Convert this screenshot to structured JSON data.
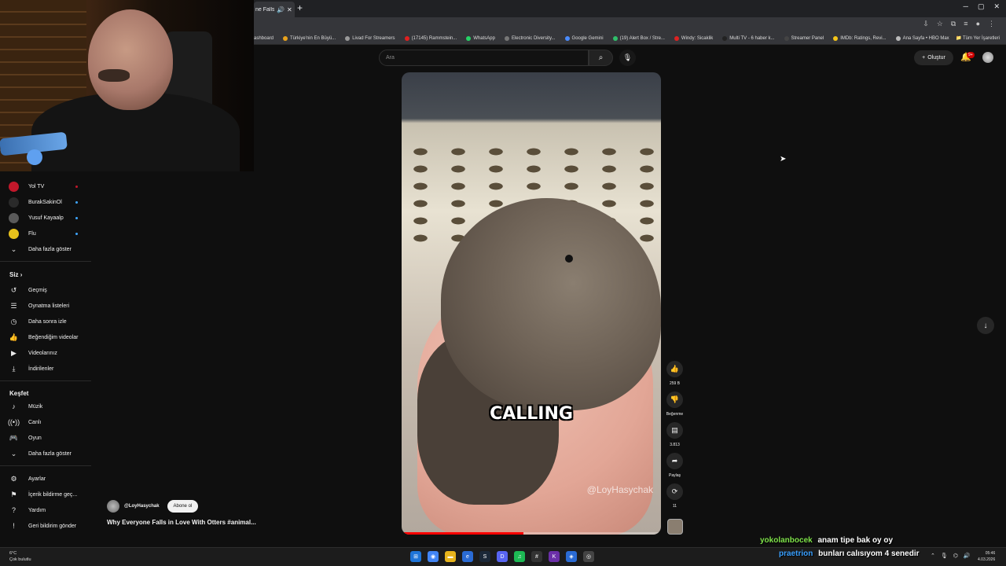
{
  "browser": {
    "tab_title": "ne Falls",
    "bookmarks": [
      "ashboard",
      "Türkiye'nin En Büyü...",
      "Livad For Streamers",
      "(17145) Rammstein...",
      "WhatsApp",
      "Electronic Diversity...",
      "Google Gemini",
      "(19) Alert Box / Stre...",
      "Windy: Sicaklik",
      "Multi TV - 6 haber k...",
      "Streamer Panel",
      "IMDb: Ratings, Revi...",
      "Ana Sayfa • HBO Max"
    ],
    "all_bookmarks": "Tüm Yer İşaretleri"
  },
  "header": {
    "search_placeholder": "Ara",
    "create_label": "Oluştur",
    "notification_count": "9+"
  },
  "sidebar": {
    "subscriptions": [
      {
        "label": "Yol TV",
        "color": "#c2182b"
      },
      {
        "label": "BurakSakinOl",
        "color": "#2a2a2a"
      },
      {
        "label": "Yusuf Kayaalp",
        "color": "#5a5a5a"
      },
      {
        "label": "Flu",
        "color": "#e8c21c"
      }
    ],
    "show_more": "Daha fazla göster",
    "you_heading": "Siz",
    "you_items": [
      "Geçmiş",
      "Oynatma listeleri",
      "Daha sonra izle",
      "Beğendiğim videolar",
      "Videolarınız",
      "İndirilenler"
    ],
    "explore_heading": "Keşfet",
    "explore_items": [
      "Müzik",
      "Canlı",
      "Oyun",
      "Daha fazla göster"
    ],
    "settings_items": [
      "Ayarlar",
      "İçerik bildirme geç...",
      "Yardım",
      "Geri bildirim gönder"
    ]
  },
  "short": {
    "caption": "CALLING",
    "watermark": "@LoyHasychak",
    "progress": 0.47,
    "channel": "@LoyHasychak",
    "subscribe_label": "Abone ol",
    "title": "Why Everyone Falls in Love With Otters #animal...",
    "likes": "259 B",
    "dislike_label": "Beğenme",
    "comments": "3.813",
    "share_label": "Paylaş",
    "remix_count": "11"
  },
  "chat": [
    {
      "user": "yokolanbocek",
      "user_color": "#7fe34a",
      "message": "anam tipe bak oy oy"
    },
    {
      "user": "praetrion",
      "user_color": "#3aa0ff",
      "message": "bunları calısıyom 4 senedir"
    }
  ],
  "taskbar": {
    "temp": "6°C",
    "weather": "Çok bulutlu",
    "time": "05:46",
    "date": "4.03.2026"
  }
}
